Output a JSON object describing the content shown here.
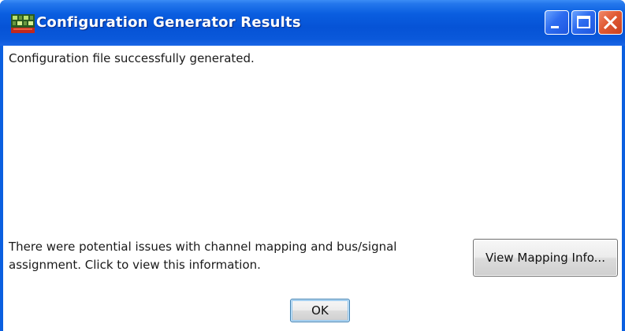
{
  "window": {
    "title": "Configuration Generator Results"
  },
  "content": {
    "status_message": "Configuration file successfully generated.",
    "issues_message": "There were potential issues with channel mapping and bus/signal assignment. Click to view this information.",
    "view_mapping_label": "View Mapping Info...",
    "ok_label": "OK"
  },
  "icons": {
    "app": "app-grid-icon",
    "minimize": "minimize-icon",
    "maximize": "maximize-icon",
    "close": "close-icon"
  },
  "colors": {
    "titlebar": "#0a5ee0",
    "close_button": "#e05a34",
    "title_text": "#ffffff"
  }
}
